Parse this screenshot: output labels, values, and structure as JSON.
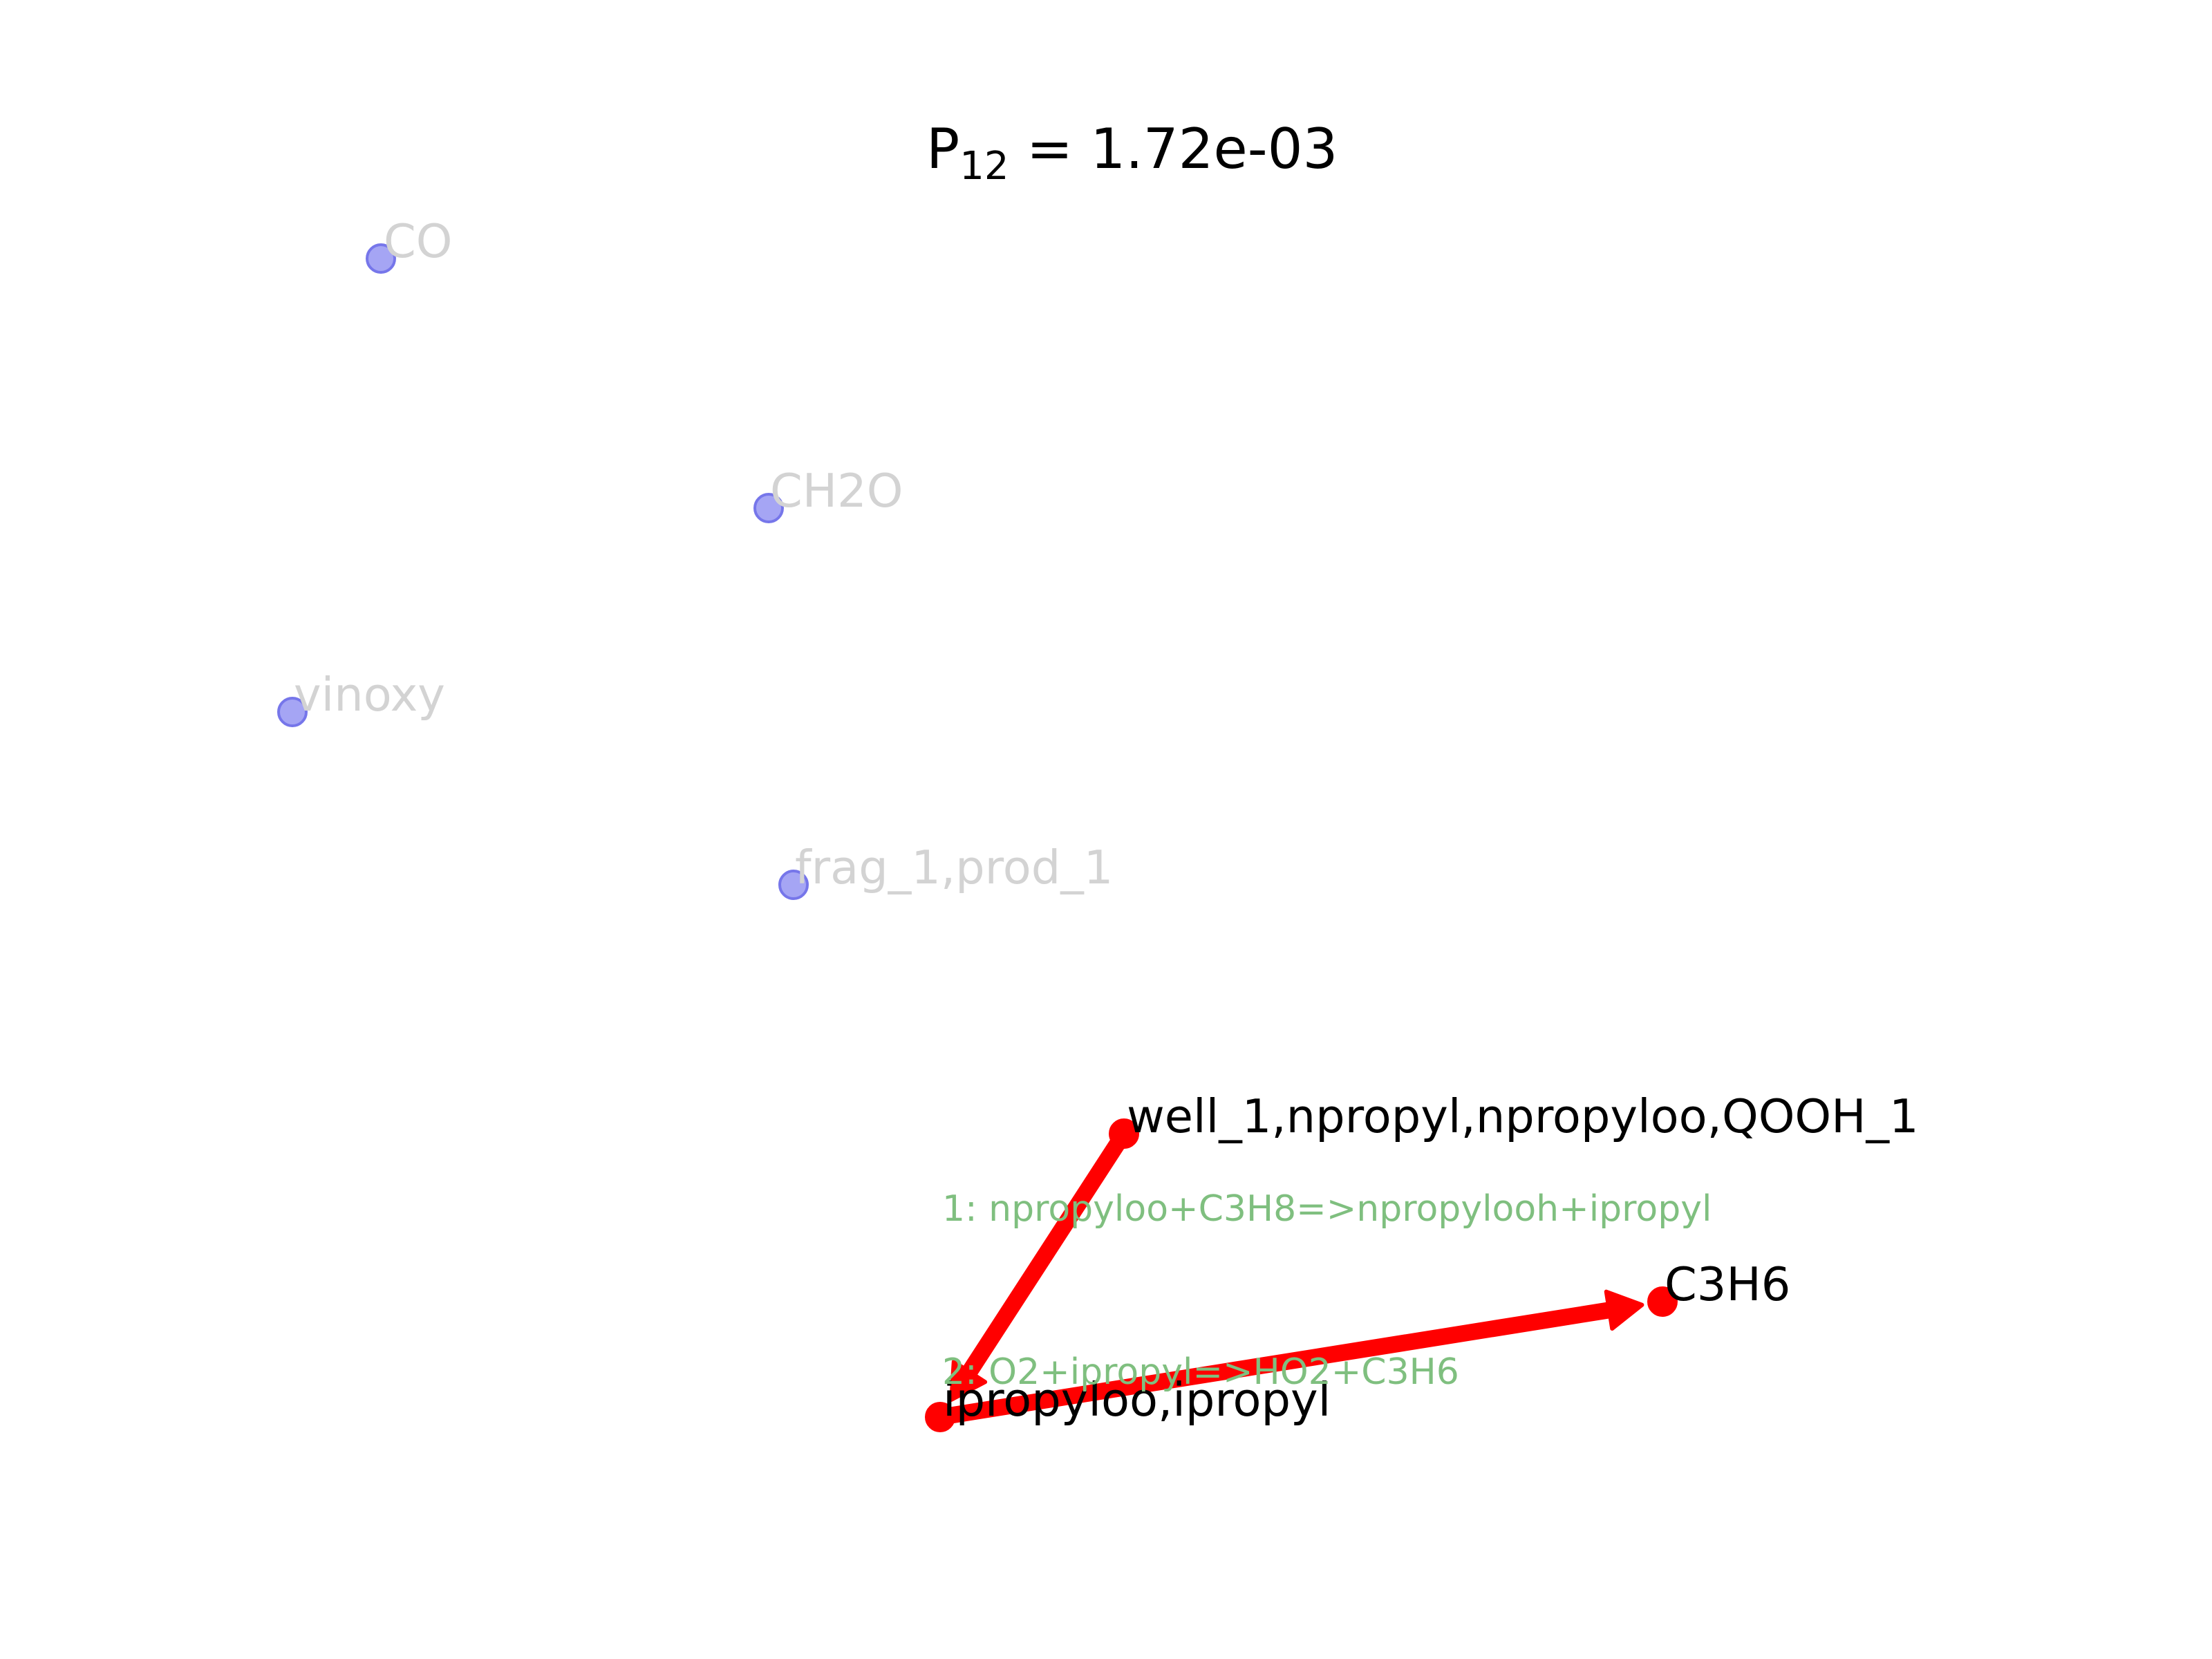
{
  "title": {
    "symbol": "P",
    "subscript": "12",
    "equals_text": " = 1.72e-03"
  },
  "colors": {
    "background": "#ffffff",
    "inactive_node_fill": "#a5a5f4",
    "inactive_node_stroke": "#7676ea",
    "inactive_label": "#d3d3d3",
    "active_node": "#ff0000",
    "active_label": "#000000",
    "path_arrow": "#ff0000",
    "reaction_label": "#7fbf7f"
  },
  "nodes": [
    {
      "id": "co",
      "label": "CO",
      "state": "inactive"
    },
    {
      "id": "ch2o",
      "label": "CH2O",
      "state": "inactive"
    },
    {
      "id": "vinoxy",
      "label": "vinoxy",
      "state": "inactive"
    },
    {
      "id": "frag1",
      "label": "frag_1,prod_1",
      "state": "inactive"
    },
    {
      "id": "well1",
      "label": "well_1,npropyl,npropyloo,QOOH_1",
      "state": "active"
    },
    {
      "id": "c3h6",
      "label": "C3H6",
      "state": "active"
    },
    {
      "id": "ipropyl",
      "label": "ipropyloo,ipropyl",
      "state": "active"
    }
  ],
  "edges": [
    {
      "id": "r1",
      "from": "well1",
      "to": "ipropyl",
      "label": "1: npropyloo+C3H8=>npropylooh+ipropyl"
    },
    {
      "id": "r2",
      "from": "ipropyl",
      "to": "c3h6",
      "label": "2: O2+ipropyl=>HO2+C3H6"
    }
  ]
}
